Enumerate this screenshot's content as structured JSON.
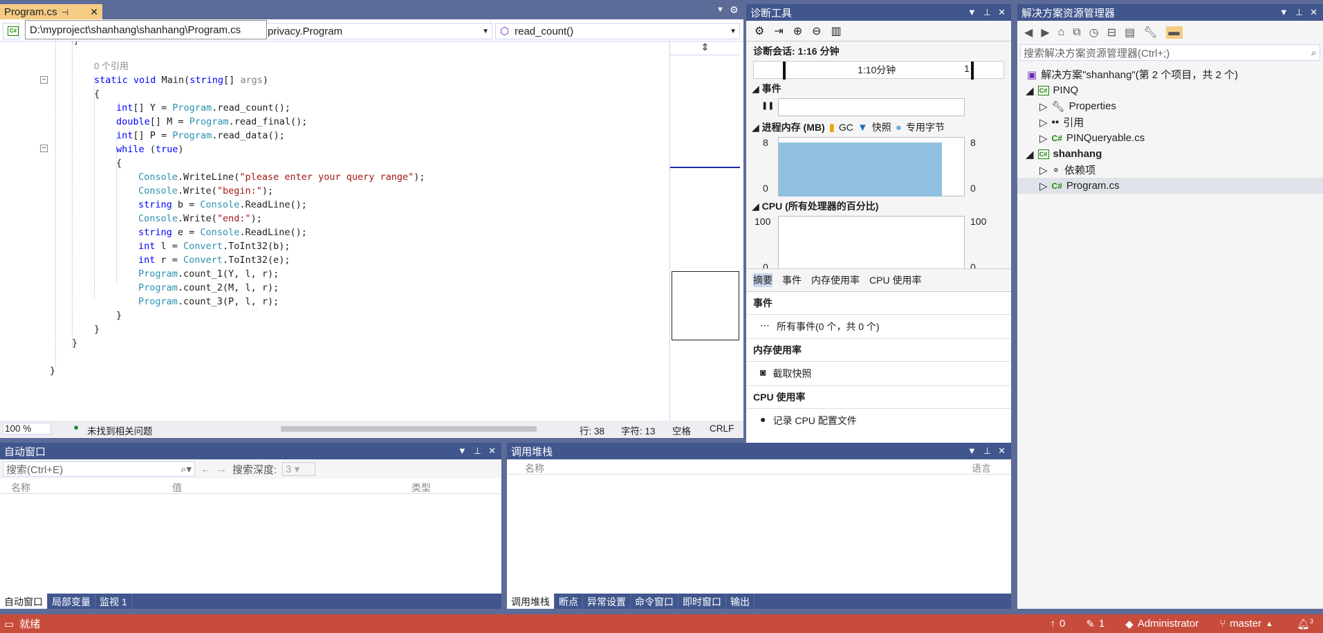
{
  "tabs": {
    "active": "Program.cs",
    "tooltip": "D:\\myproject\\shanhang\\shanhang\\Program.cs"
  },
  "navbar": {
    "project": "s",
    "class": "privacy.Program",
    "member": "read_count()"
  },
  "code": {
    "ref_count": "0 个引用",
    "lines": [
      "static void Main(string[] args)",
      "{",
      "int[] Y = Program.read_count();",
      "double[] M = Program.read_final();",
      "int[] P = Program.read_data();",
      "while (true)",
      "{",
      "Console.WriteLine(\"please enter your query range\");",
      "Console.Write(\"begin:\");",
      "string b = Console.ReadLine();",
      "Console.Write(\"end:\");",
      "string e = Console.ReadLine();",
      "int l = Convert.ToInt32(b);",
      "int r = Convert.ToInt32(e);",
      "Program.count_1(Y, l, r);",
      "Program.count_2(M, l, r);",
      "Program.count_3(P, l, r);",
      "}",
      "}",
      "}",
      "}"
    ]
  },
  "editor_status": {
    "zoom": "100 %",
    "issues": "未找到相关问题",
    "line": "行: 38",
    "char": "字符: 13",
    "ws": "空格",
    "eol": "CRLF"
  },
  "diag": {
    "title": "诊断工具",
    "session": "诊断会话: 1:16 分钟",
    "timeline_label": "1:10分钟",
    "timeline_right": "1",
    "events_hdr": "事件",
    "memory_hdr": "进程内存 (MB)",
    "legend": [
      "GC",
      "快照",
      "专用字节"
    ],
    "mem_top": "8",
    "mem_bottom": "0",
    "cpu_hdr": "CPU (所有处理器的百分比)",
    "cpu_top": "100",
    "cpu_bottom": "0",
    "tabs": [
      "摘要",
      "事件",
      "内存使用率",
      "CPU 使用率"
    ],
    "summary": [
      {
        "hdr": "事件",
        "item": "所有事件(0 个，共 0 个)"
      },
      {
        "hdr": "内存使用率",
        "item": "截取快照"
      },
      {
        "hdr": "CPU 使用率",
        "item": "记录 CPU 配置文件"
      }
    ],
    "memory_fill": 0.88
  },
  "solution": {
    "title": "解决方案资源管理器",
    "search_placeholder": "搜索解决方案资源管理器(Ctrl+;)",
    "items": [
      {
        "label": "解决方案\"shanhang\"(第 2 个项目，共 2 个)"
      },
      {
        "label": "PINQ"
      },
      {
        "label": "Properties"
      },
      {
        "label": "引用"
      },
      {
        "label": "PINQueryable.cs"
      },
      {
        "label": "shanhang"
      },
      {
        "label": "依赖项"
      },
      {
        "label": "Program.cs"
      }
    ]
  },
  "auto": {
    "title": "自动窗口",
    "search_placeholder": "搜索(Ctrl+E)",
    "depth_label": "搜索深度:",
    "depth_value": "3",
    "cols": [
      "名称",
      "值",
      "类型"
    ],
    "tabs": [
      "自动窗口",
      "局部变量",
      "监视 1"
    ]
  },
  "callstack": {
    "title": "调用堆栈",
    "cols": [
      "名称",
      "语言"
    ],
    "tabs": [
      "调用堆栈",
      "断点",
      "异常设置",
      "命令窗口",
      "即时窗口",
      "输出"
    ]
  },
  "status": {
    "ready": "就绪",
    "up": "0",
    "pen": "1",
    "user": "Administrator",
    "branch": "master",
    "notif": "3"
  }
}
